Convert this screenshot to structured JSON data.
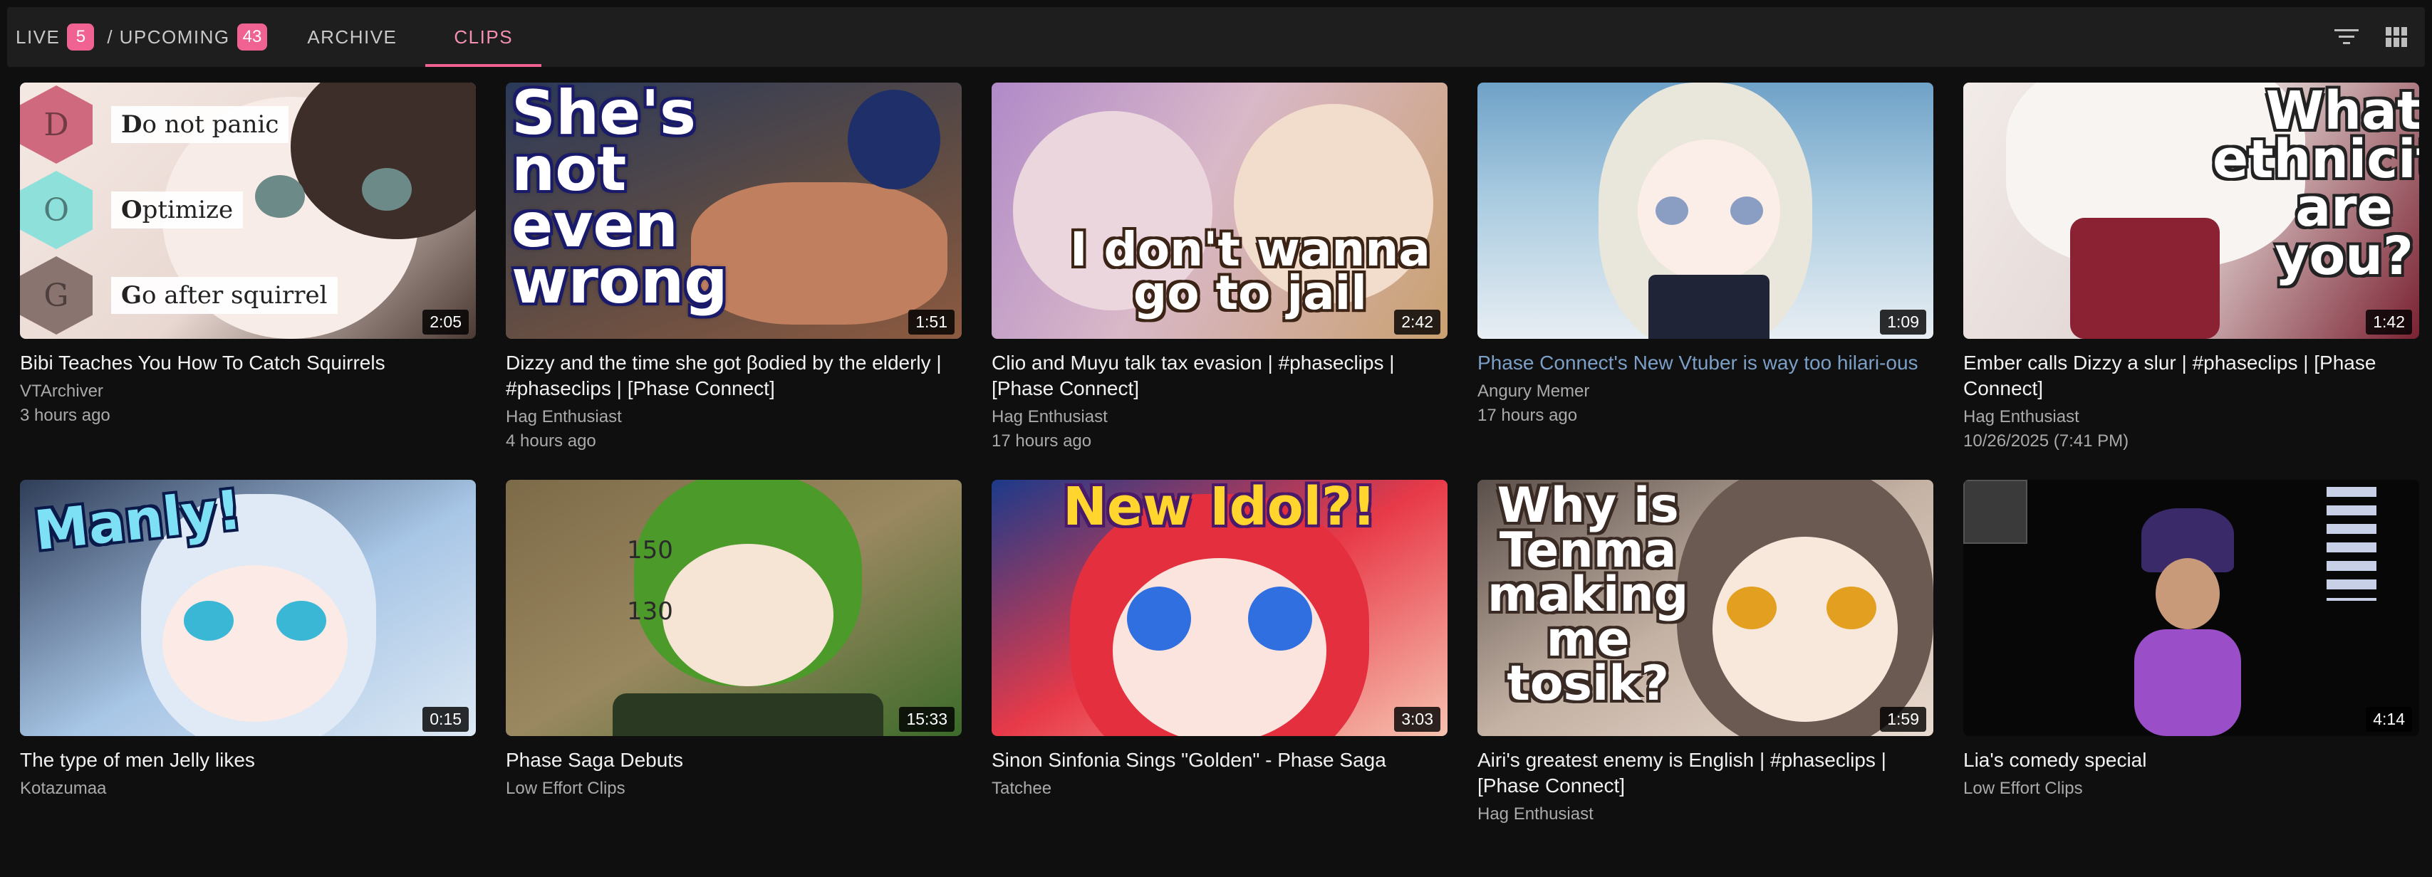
{
  "tabs": {
    "live_label": "LIVE",
    "live_count": "5",
    "separator": "/",
    "upcoming_label": "UPCOMING",
    "upcoming_count": "43",
    "archive_label": "ARCHIVE",
    "clips_label": "CLIPS",
    "active": "CLIPS"
  },
  "toolbar": {
    "filter_icon": "filter-icon",
    "grid_icon": "grid-view-icon"
  },
  "colors": {
    "accent": "#f06292",
    "background": "#0f0f0f",
    "bar": "#1e1e1e",
    "link": "#7b9fc7"
  },
  "videos": [
    {
      "title": "Bibi Teaches You How To Catch Squirrels",
      "channel": "VTArchiver",
      "time": "3 hours ago",
      "duration": "2:05",
      "overlay": {
        "d_letter": "D",
        "d_bold": "D",
        "d_text": "o not panic",
        "o_letter": "O",
        "o_bold": "O",
        "o_text": "ptimize",
        "g_letter": "G",
        "g_bold": "G",
        "g_text": "o after squirrel"
      }
    },
    {
      "title": "Dizzy and the time she got βodied by the elderly | #phaseclips | [Phase Connect]",
      "channel": "Hag Enthusiast",
      "time": "4 hours ago",
      "duration": "1:51",
      "overlay_text": [
        "She's",
        "not",
        "even",
        "wrong"
      ]
    },
    {
      "title": "Clio and Muyu talk tax evasion | #phaseclips | [Phase Connect]",
      "channel": "Hag Enthusiast",
      "time": "17 hours ago",
      "duration": "2:42",
      "overlay_text": [
        "I don't wanna",
        "go to jail"
      ]
    },
    {
      "title": "Phase Connect's New Vtuber is way too hilari-ous",
      "channel": "Angury Memer",
      "time": "17 hours ago",
      "duration": "1:09",
      "watched": true
    },
    {
      "title": "Ember calls Dizzy a slur | #phaseclips | [Phase Connect]",
      "channel": "Hag Enthusiast",
      "time": "10/26/2025 (7:41 PM)",
      "duration": "1:42",
      "overlay_text": [
        "What",
        "ethnicity",
        "are",
        "you?"
      ]
    },
    {
      "title": "The type of men Jelly likes",
      "channel": "Kotazumaa",
      "time": "",
      "duration": "0:15",
      "overlay_text": [
        "Manly!"
      ]
    },
    {
      "title": "Phase Saga Debuts",
      "channel": "Low Effort Clips",
      "time": "",
      "duration": "15:33",
      "overlay_text": [
        "150",
        "130"
      ]
    },
    {
      "title": "Sinon Sinfonia Sings \"Golden\" - Phase Saga",
      "channel": "Tatchee",
      "time": "",
      "duration": "3:03",
      "overlay_text": [
        "New Idol?!"
      ]
    },
    {
      "title": "Airi's greatest enemy is English | #phaseclips | [Phase Connect]",
      "channel": "Hag Enthusiast",
      "time": "",
      "duration": "1:59",
      "overlay_text": [
        "Why is",
        "Tenma",
        "making",
        "me",
        "tosik?"
      ]
    },
    {
      "title": "Lia's comedy special",
      "channel": "Low Effort Clips",
      "time": "",
      "duration": "4:14"
    }
  ]
}
